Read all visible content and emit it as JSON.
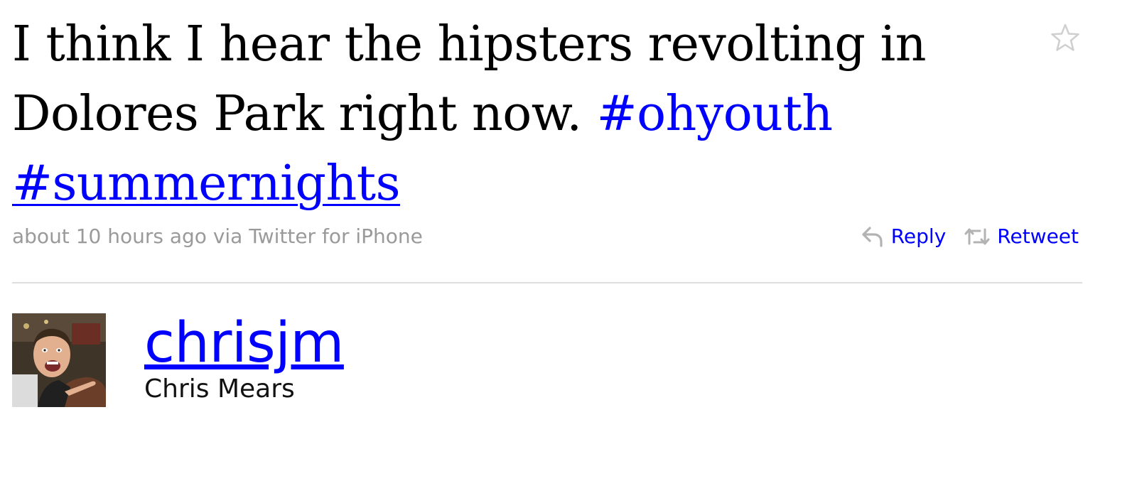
{
  "tweet": {
    "text_before": "I think I hear the hipsters revolting in Dolores Park right now. ",
    "hashtags": [
      "#ohyouth",
      "#summernights"
    ],
    "timestamp": "about 10 hours ago",
    "via_text": "via Twitter for iPhone"
  },
  "actions": {
    "reply_label": "Reply",
    "retweet_label": "Retweet"
  },
  "author": {
    "screen_name": "chrisjm",
    "full_name": "Chris Mears"
  },
  "colors": {
    "link": "#0000ff",
    "meta_text": "#9a9a9a",
    "divider": "#dedede",
    "icon_gray": "#b3b3b3"
  },
  "icons": [
    "star-icon",
    "reply-icon",
    "retweet-icon"
  ]
}
